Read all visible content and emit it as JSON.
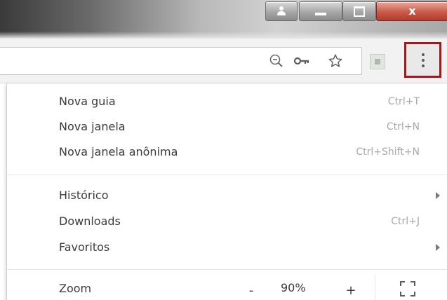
{
  "window": {
    "controls": [
      "user-icon",
      "minimize-icon",
      "maximize-icon",
      "close-icon"
    ],
    "close_glyph": "x",
    "close_color": "#c0402e"
  },
  "toolbar": {
    "icons": [
      "zoom-out-icon",
      "key-icon",
      "star-icon",
      "extension-icon",
      "more-vert-icon"
    ],
    "highlight_color": "#a3171d"
  },
  "menu": {
    "items": [
      {
        "label": "Nova guia",
        "shortcut": "Ctrl+T"
      },
      {
        "label": "Nova janela",
        "shortcut": "Ctrl+N"
      },
      {
        "label": "Nova janela anônima",
        "shortcut": "Ctrl+Shift+N"
      },
      {
        "label": "Histórico",
        "submenu": true
      },
      {
        "label": "Downloads",
        "shortcut": "Ctrl+J"
      },
      {
        "label": "Favoritos",
        "submenu": true
      }
    ],
    "zoom": {
      "label": "Zoom",
      "minus": "-",
      "value": "90%",
      "plus": "+",
      "fullscreen_icon": "fullscreen-icon"
    }
  }
}
